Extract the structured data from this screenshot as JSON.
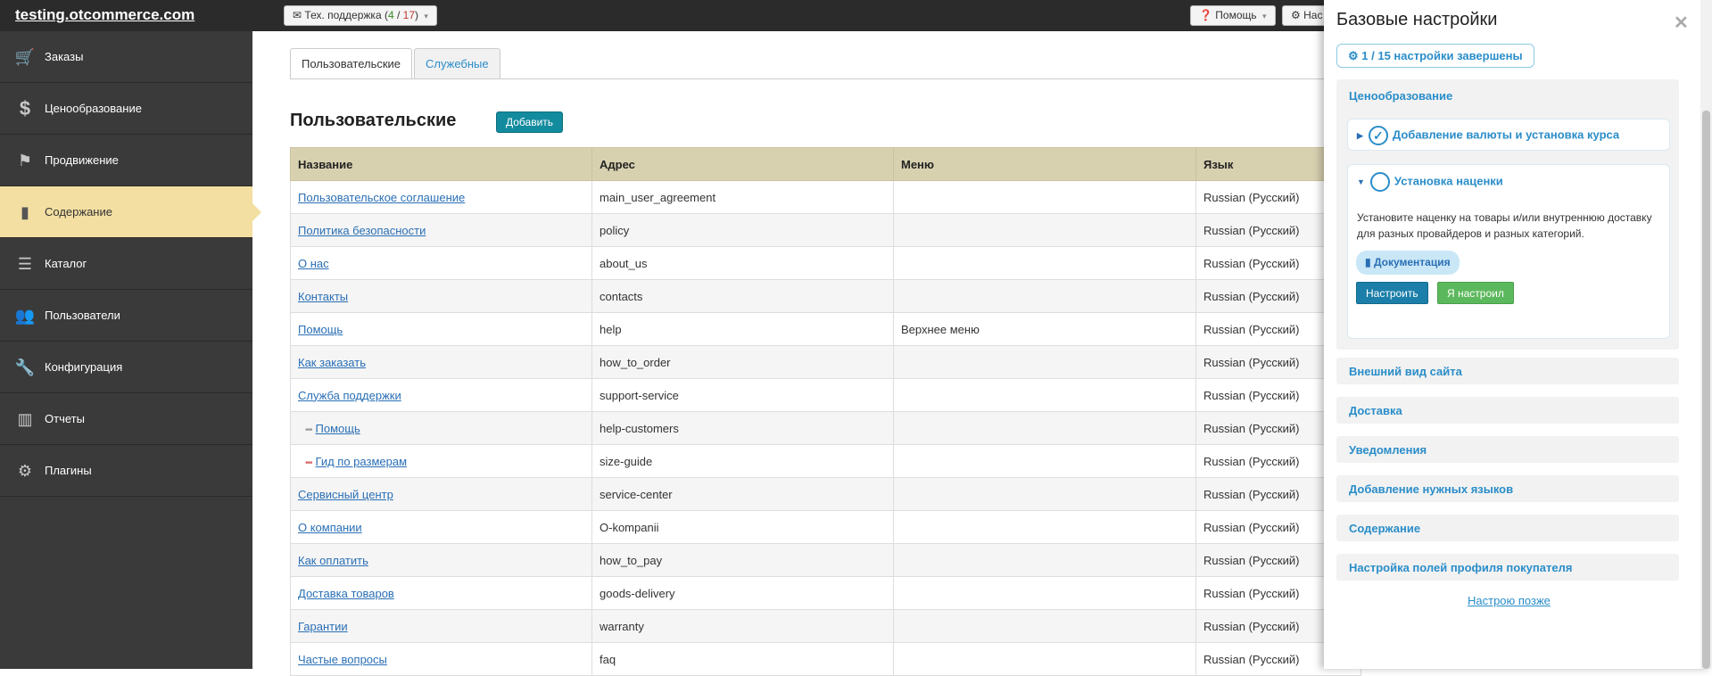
{
  "topbar": {
    "brand": "testing.otcommerce.com",
    "support": {
      "label": "Тех. поддержка (",
      "open": "4",
      "sep": " / ",
      "total": "17",
      "close": ")"
    },
    "help_label": "Помощь",
    "settings_label": "Нас"
  },
  "sidebar": {
    "items": [
      {
        "label": "Заказы",
        "icon": "cart-icon"
      },
      {
        "label": "Ценообразование",
        "icon": "dollar-icon"
      },
      {
        "label": "Продвижение",
        "icon": "flag-icon"
      },
      {
        "label": "Содержание",
        "icon": "document-icon"
      },
      {
        "label": "Каталог",
        "icon": "catalog-icon"
      },
      {
        "label": "Пользователи",
        "icon": "users-icon"
      },
      {
        "label": "Конфигурация",
        "icon": "wrench-icon"
      },
      {
        "label": "Отчеты",
        "icon": "chart-icon"
      },
      {
        "label": "Плагины",
        "icon": "gear-icon"
      }
    ],
    "active_index": 3
  },
  "main": {
    "tabs": [
      "Пользовательские",
      "Служебные"
    ],
    "title": "Пользовательские",
    "add_label": "Добавить",
    "columns": [
      "Название",
      "Адрес",
      "Меню",
      "Язык"
    ],
    "rows": [
      {
        "name": "Пользовательское соглашение",
        "address": "main_user_agreement",
        "menu": "",
        "lang": "Russian (Русский)"
      },
      {
        "name": "Политика безопасности",
        "address": "policy",
        "menu": "",
        "lang": "Russian (Русский)"
      },
      {
        "name": "О нас",
        "address": "about_us",
        "menu": "",
        "lang": "Russian (Русский)"
      },
      {
        "name": "Контакты",
        "address": "contacts",
        "menu": "",
        "lang": "Russian (Русский)"
      },
      {
        "name": "Помощь",
        "address": "help",
        "menu": "Верхнее меню",
        "lang": "Russian (Русский)"
      },
      {
        "name": "Как заказать",
        "address": "how_to_order",
        "menu": "",
        "lang": "Russian (Русский)"
      },
      {
        "name": "Служба поддержки",
        "address": "support-service",
        "menu": "",
        "lang": "Russian (Русский)"
      },
      {
        "name": "Помощь",
        "address": "help-customers",
        "menu": "",
        "lang": "Russian (Русский)",
        "sub": "gray"
      },
      {
        "name": "Гид по размерам",
        "address": "size-guide",
        "menu": "",
        "lang": "Russian (Русский)",
        "sub": "red"
      },
      {
        "name": "Сервисный центр",
        "address": "service-center",
        "menu": "",
        "lang": "Russian (Русский)"
      },
      {
        "name": "О компании",
        "address": "O-kompanii",
        "menu": "",
        "lang": "Russian (Русский)"
      },
      {
        "name": "Как оплатить",
        "address": "how_to_pay",
        "menu": "",
        "lang": "Russian (Русский)"
      },
      {
        "name": "Доставка товаров",
        "address": "goods-delivery",
        "menu": "",
        "lang": "Russian (Русский)"
      },
      {
        "name": "Гарантии",
        "address": "warranty",
        "menu": "",
        "lang": "Russian (Русский)"
      },
      {
        "name": "Частые вопросы",
        "address": "faq",
        "menu": "",
        "lang": "Russian (Русский)"
      }
    ]
  },
  "panel": {
    "title": "Базовые настройки",
    "progress": "1 / 15 настройки завершены",
    "pricing_group": "Ценообразование",
    "step1": "Добавление валюты и установка курса",
    "step2": "Установка наценки",
    "step2_desc": "Установите наценку на товары и/или внутреннюю доставку для разных провайдеров и разных категорий.",
    "doc_label": "Документация",
    "configure_label": "Настроить",
    "done_label": "Я настроил",
    "groups": [
      "Внешний вид сайта",
      "Доставка",
      "Уведомления",
      "Добавление нужных языков",
      "Содержание",
      "Настройка полей профиля покупателя"
    ],
    "later_label": "Настрою позже"
  },
  "colors": {
    "accent": "#2a8dc9",
    "active_nav": "#f3dfa2",
    "table_header": "#d8d1b0"
  }
}
